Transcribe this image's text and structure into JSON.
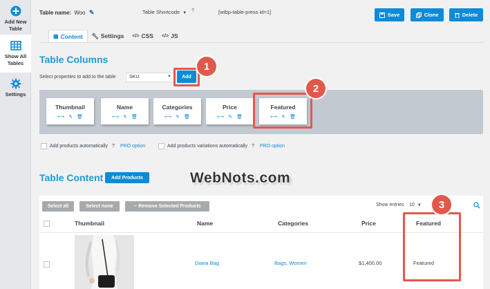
{
  "sidebar": {
    "items": [
      {
        "label_line1": "Add New",
        "label_line2": "Table",
        "icon": "plus-circle-icon"
      },
      {
        "label_line1": "Show All",
        "label_line2": "Tables",
        "icon": "grid-table-icon"
      },
      {
        "label_line1": "Settings",
        "label_line2": "",
        "icon": "gear-icon"
      }
    ]
  },
  "header": {
    "table_name_label": "Table name:",
    "table_name_value": "Woo",
    "shortcode_label": "Table Shortcode",
    "shortcode_help": "?",
    "shortcode_value": "[wtbp-table-press id=1]",
    "buttons": {
      "save": "Save",
      "clone": "Clone",
      "delete": "Delete"
    }
  },
  "tabs": [
    {
      "label": "Content",
      "active": true
    },
    {
      "label": "Settings",
      "active": false
    },
    {
      "label": "CSS",
      "active": false
    },
    {
      "label": "JS",
      "active": false
    }
  ],
  "table_columns": {
    "heading": "Table Columns",
    "select_label": "Select properties to add to the table",
    "selected_property": "SKU",
    "add_button": "Add",
    "columns": [
      "Thumbnail",
      "Name",
      "Categories",
      "Price",
      "Featured"
    ],
    "options": [
      {
        "label": "Add products automatically",
        "help": "?",
        "pro": "PRO option"
      },
      {
        "label": "Add products variations automatically",
        "help": "?",
        "pro": "PRO option"
      }
    ]
  },
  "table_content": {
    "heading": "Table Content",
    "add_products_button": "Add Products",
    "select_all": "Select all",
    "select_none": "Select none",
    "remove_selected": "Remove Selected Products",
    "show_entries_label": "Show entries",
    "show_entries_value": "10",
    "headers": [
      "Thumbnail",
      "Name",
      "Categories",
      "Price",
      "Featured"
    ],
    "rows": [
      {
        "name": "Diana Bag",
        "categories": "Bags, Women",
        "price": "$1,400.00",
        "featured": "Featured"
      }
    ]
  },
  "annotations": {
    "badge1": "1",
    "badge2": "2",
    "badge3": "3"
  },
  "watermark": "WebNots.com",
  "colors": {
    "accent": "#0f8bd6",
    "heading": "#1d9bd4",
    "highlight": "#e2584c",
    "grey_button": "#a7aaad"
  }
}
